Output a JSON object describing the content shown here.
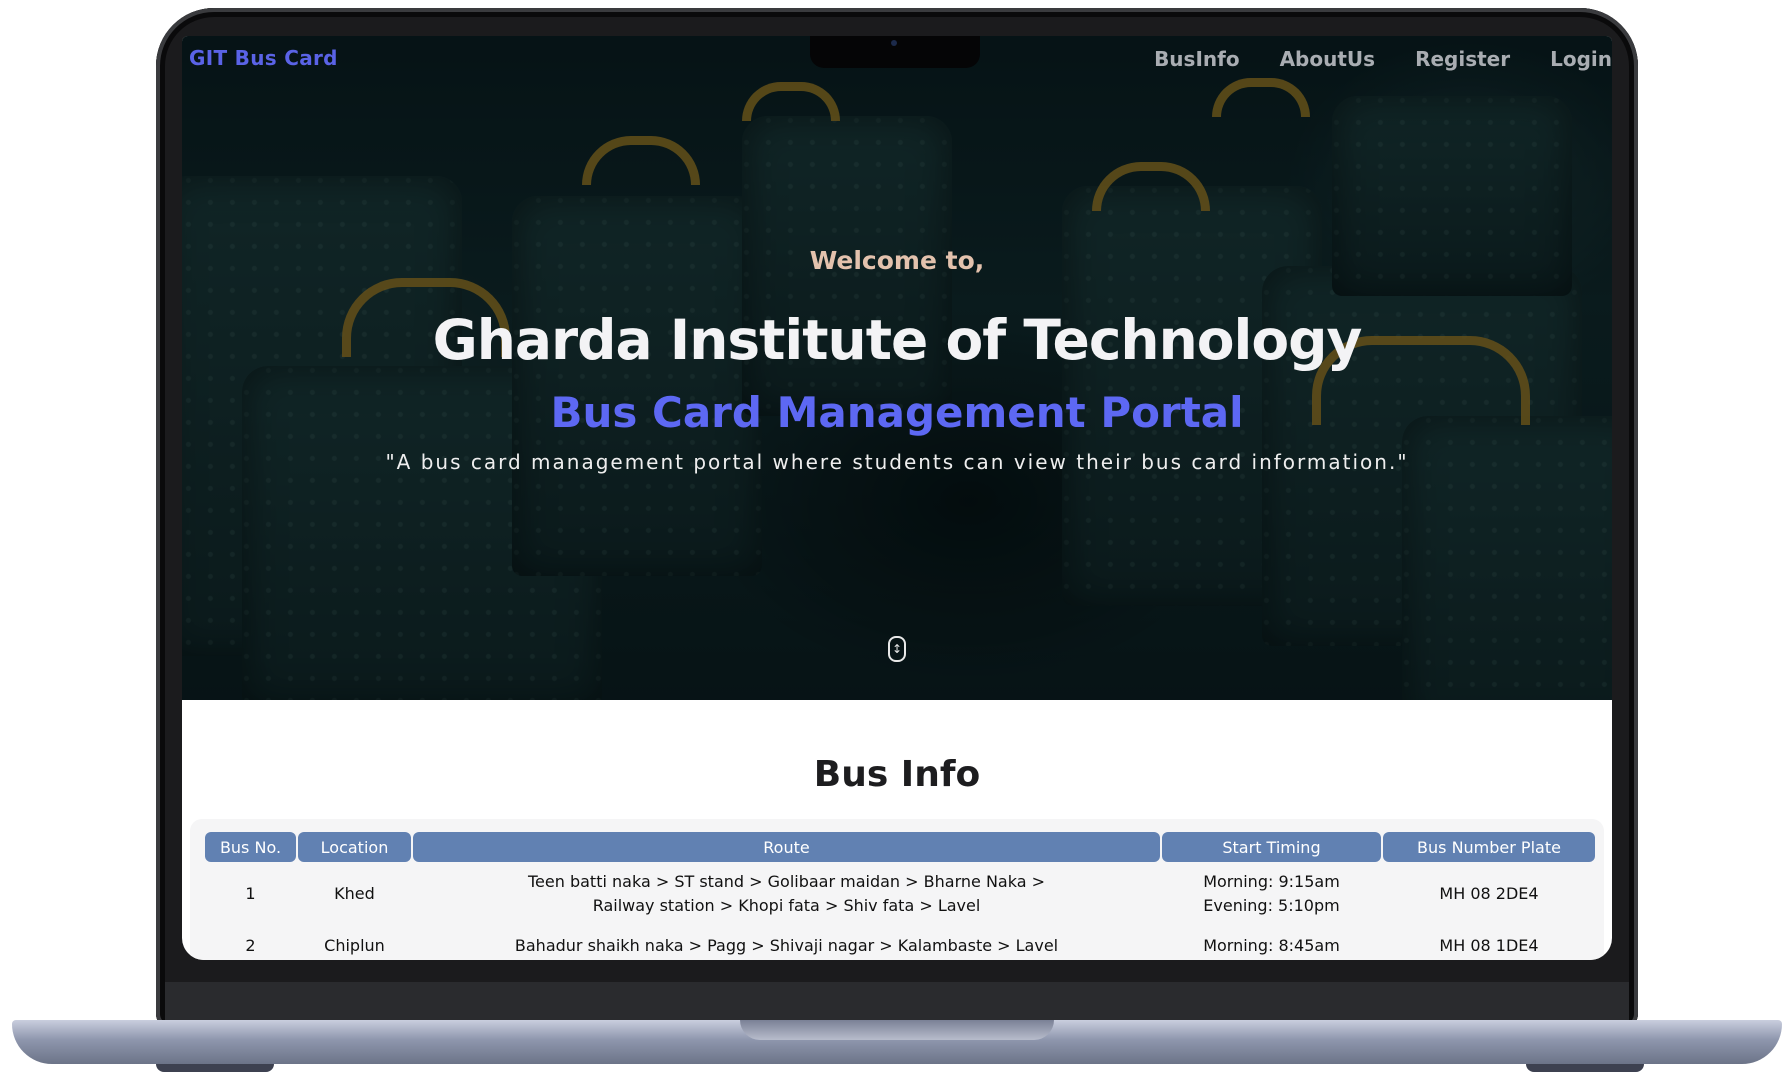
{
  "brand": "GIT Bus Card",
  "nav": [
    "BusInfo",
    "AboutUs",
    "Register",
    "Login"
  ],
  "hero": {
    "welcome": "Welcome to,",
    "title": "Gharda Institute of Technology",
    "subtitle": "Bus Card Management Portal",
    "tagline": "\"A bus card management portal where students can view their bus card information.\""
  },
  "bus_info": {
    "title": "Bus Info",
    "columns": [
      "Bus No.",
      "Location",
      "Route",
      "Start Timing",
      "Bus Number Plate"
    ],
    "rows": [
      {
        "bus_no": "1",
        "location": "Khed",
        "route_line1": "Teen batti naka > ST stand > Golibaar maidan > Bharne Naka >",
        "route_line2": "Railway station > Khopi fata > Shiv fata > Lavel",
        "timing_morning": "Morning: 9:15am",
        "timing_evening": "Evening: 5:10pm",
        "plate": "MH 08 2DE4"
      },
      {
        "bus_no": "2",
        "location": "Chiplun",
        "route_line1": "Bahadur shaikh naka > Pagg > Shivaji nagar > Kalambaste > Lavel",
        "route_line2": "",
        "timing_morning": "Morning: 8:45am",
        "timing_evening": "",
        "plate": "MH 08 1DE4"
      }
    ]
  },
  "colors": {
    "brand": "#5a63e6",
    "subtitle": "#5d68f3",
    "table_header": "#6181b2",
    "welcome": "#e3c2ad"
  },
  "icons": {
    "scroll": "mouse-scroll-icon"
  }
}
